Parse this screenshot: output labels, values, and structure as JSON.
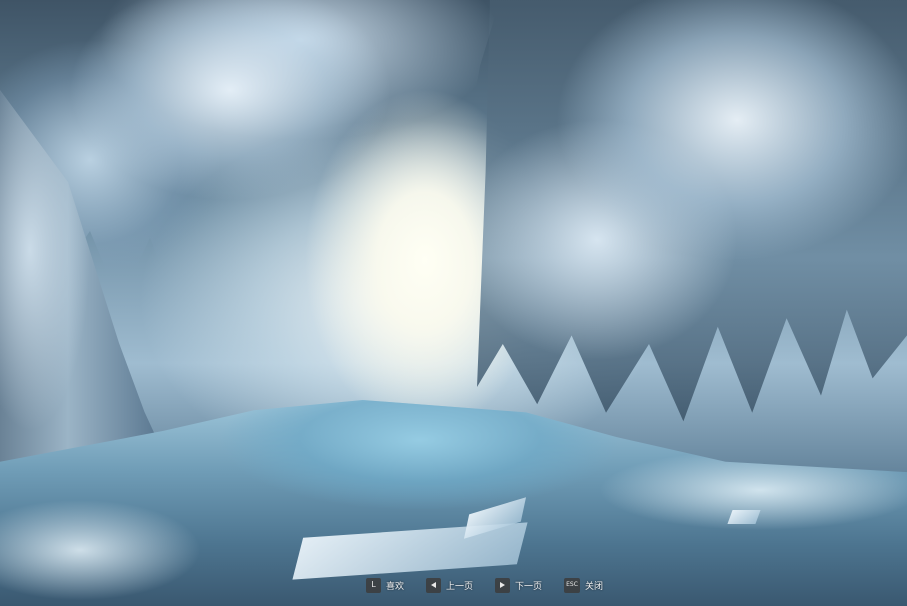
{
  "controls": {
    "like": {
      "key": "L",
      "label": "喜欢"
    },
    "prev": {
      "icon": "triangle-left-icon",
      "label": "上一页"
    },
    "next": {
      "icon": "triangle-right-icon",
      "label": "下一页"
    },
    "close": {
      "key": "ESC",
      "label": "关闭"
    }
  },
  "colors": {
    "key_background": "#3c3c3c",
    "label_text": "#f2f2f2"
  }
}
